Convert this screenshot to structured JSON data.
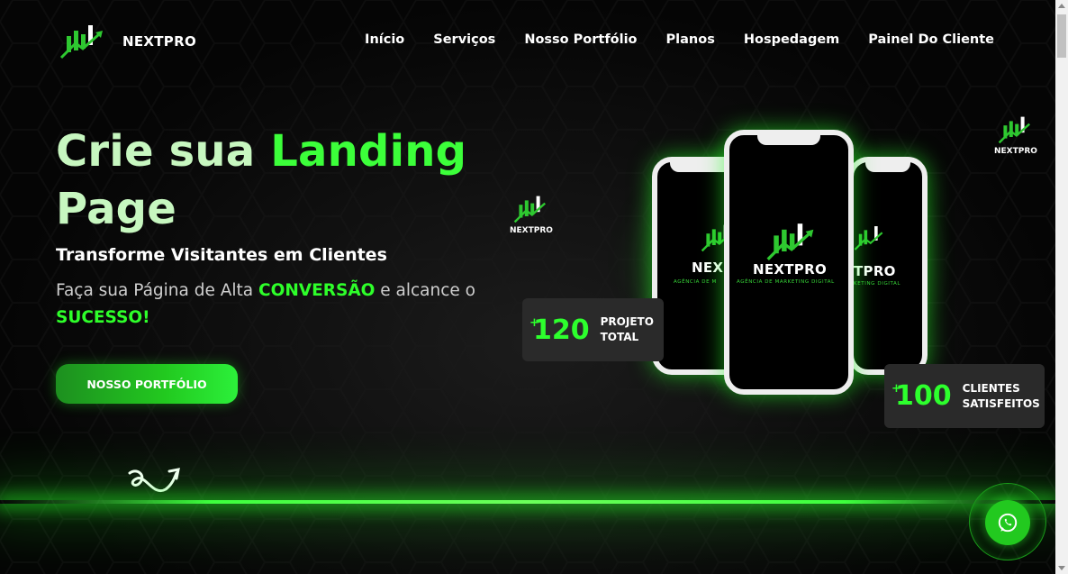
{
  "header": {
    "logo_text": "NEXTPRO",
    "nav": [
      "Início",
      "Serviços",
      "Nosso Portfólio",
      "Planos",
      "Hospedagem",
      "Painel Do Cliente"
    ]
  },
  "hero": {
    "title_part1": "Crie sua ",
    "title_part2": "Landing",
    "title_part3": "Page",
    "subtitle": "Transforme Visitantes em Clientes",
    "desc_part1": "Faça sua Página de Alta ",
    "desc_highlight1": "CONVERSÃO",
    "desc_part2": " e alcance o ",
    "desc_highlight2": "SUCESSO!",
    "cta_label": "NOSSO PORTFÓLIO"
  },
  "phones": {
    "brand": "NEXTPRO",
    "left_brand": "NEX",
    "right_brand": "TPRO",
    "tagline": "AGÊNCIA DE MARKETING DIGITAL",
    "left_tagline": "AGÊNCIA DE M",
    "right_tagline": "KETING DIGITAL"
  },
  "stats": [
    {
      "prefix": "+",
      "value": "120",
      "label_line1": "PROJETO",
      "label_line2": "TOTAL"
    },
    {
      "prefix": "+",
      "value": "100",
      "label_line1": "CLIENTES",
      "label_line2": "SATISFEITOS"
    }
  ],
  "floating_logos": [
    "NEXTPRO",
    "NEXTPRO"
  ],
  "colors": {
    "accent": "#2dff2d",
    "background": "#030303",
    "title_light": "#c7f7c0"
  },
  "icons": {
    "whatsapp": "whatsapp-icon",
    "arrow": "curly-arrow-icon",
    "logo": "growth-chart-logo-icon"
  }
}
